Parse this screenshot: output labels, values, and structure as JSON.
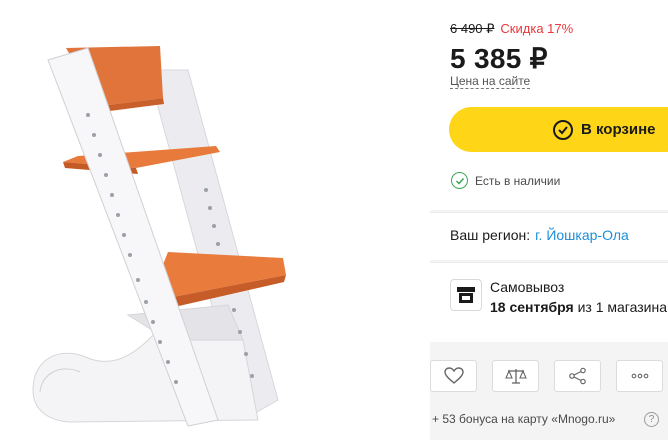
{
  "product": {
    "image": "chair-icon"
  },
  "pricing": {
    "old_price": "6 490 ₽",
    "discount": "Скидка 17%",
    "price": "5 385 ₽",
    "price_note": "Цена на сайте"
  },
  "cart": {
    "label": "В корзине",
    "icon": "check-circle-icon"
  },
  "stock": {
    "label": "Есть в наличии",
    "icon": "check-circle-icon",
    "color": "#3aa856"
  },
  "region": {
    "label": "Ваш регион:",
    "city": "г. Йошкар-Ола"
  },
  "pickup": {
    "title": "Самовывоз",
    "date": "18 сентября",
    "stores": "из 1 магазина",
    "icon": "store-icon"
  },
  "actions": [
    {
      "name": "favorite",
      "icon": "heart-icon"
    },
    {
      "name": "compare",
      "icon": "scales-icon"
    },
    {
      "name": "share",
      "icon": "share-icon"
    },
    {
      "name": "more",
      "icon": "more-icon"
    }
  ],
  "bonus": {
    "text": "+ 53 бонуса на карту «Mnogo.ru»",
    "help": "?"
  },
  "colors": {
    "accent": "#ffd617",
    "discount": "#e8383d",
    "link": "#1e8ed6",
    "panel": "#f4f4f5"
  }
}
